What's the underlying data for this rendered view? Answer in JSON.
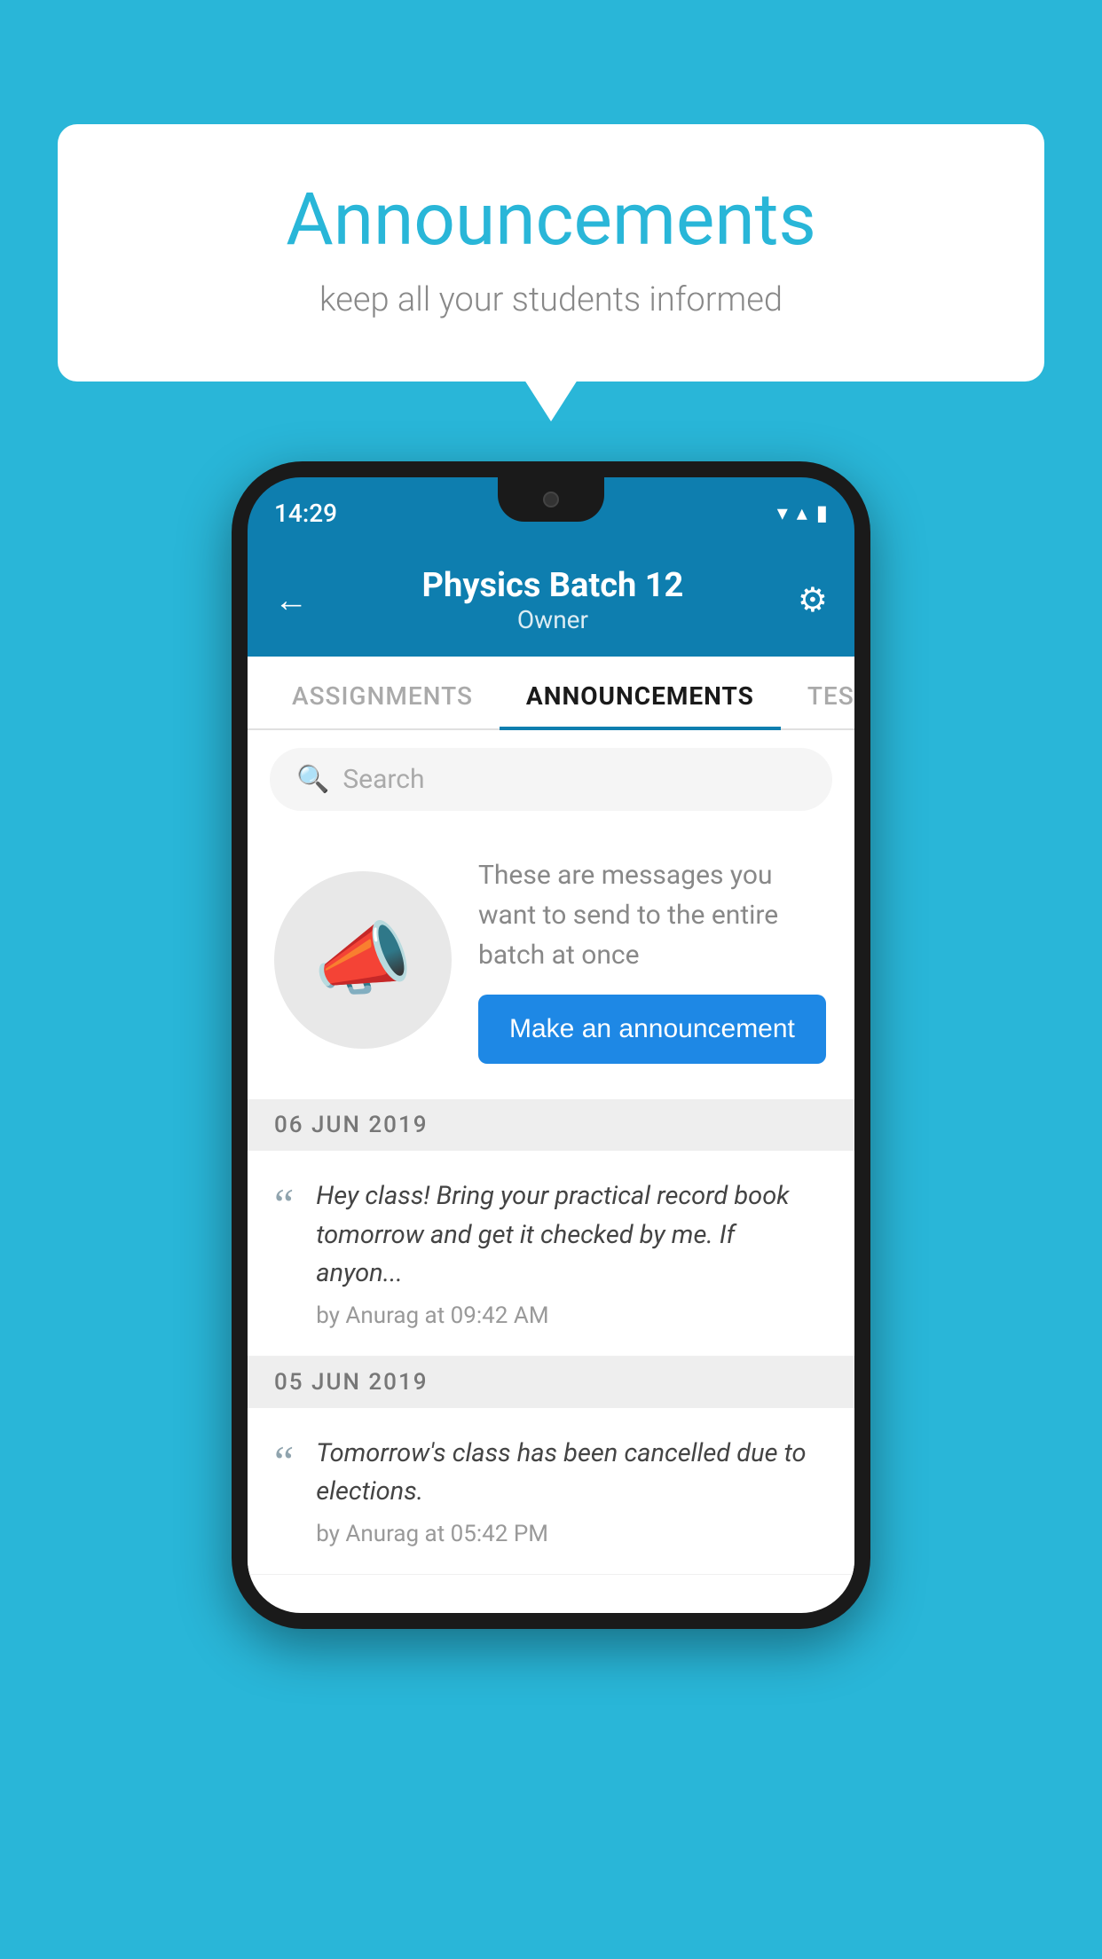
{
  "background_color": "#29b6d8",
  "speech_bubble": {
    "title": "Announcements",
    "subtitle": "keep all your students informed"
  },
  "phone": {
    "status_bar": {
      "time": "14:29",
      "wifi": "▾",
      "signal": "▴",
      "battery": "▮"
    },
    "header": {
      "back_label": "←",
      "title": "Physics Batch 12",
      "subtitle": "Owner",
      "gear_label": "⚙"
    },
    "tabs": [
      {
        "label": "ASSIGNMENTS",
        "active": false
      },
      {
        "label": "ANNOUNCEMENTS",
        "active": true
      },
      {
        "label": "TESTS",
        "active": false
      }
    ],
    "search": {
      "placeholder": "Search"
    },
    "announcement_intro": {
      "description": "These are messages you want to send to the entire batch at once",
      "button_label": "Make an announcement"
    },
    "announcements": [
      {
        "date": "06  JUN  2019",
        "text": "Hey class! Bring your practical record book tomorrow and get it checked by me. If anyon...",
        "meta": "by Anurag at 09:42 AM"
      },
      {
        "date": "05  JUN  2019",
        "text": "Tomorrow's class has been cancelled due to elections.",
        "meta": "by Anurag at 05:42 PM"
      }
    ]
  }
}
